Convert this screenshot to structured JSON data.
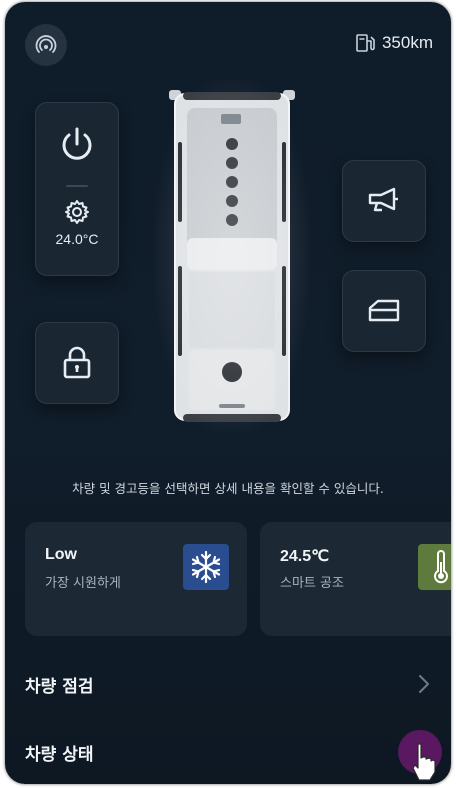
{
  "header": {
    "range_value": "350km",
    "icons": [
      "signal-icon",
      "fuel-pump-icon"
    ]
  },
  "climate_control": {
    "temperature": "24.0°C",
    "icons": [
      "power-icon",
      "gear-icon"
    ]
  },
  "controls": {
    "lock_icon": "lock-icon",
    "horn_icon": "horn-icon",
    "window_icon": "window-icon"
  },
  "hint_text": "차량 및 경고등을 선택하면 상세 내용을 확인할 수 있습니다.",
  "cards": [
    {
      "title": "Low",
      "subtitle": "가장 시원하게",
      "icon": "snowflake-icon",
      "icon_bg": "#2a4d8f"
    },
    {
      "title": "24.5℃",
      "subtitle": "스마트 공조",
      "icon": "thermometer-icon",
      "icon_bg": "#5e7a3c"
    }
  ],
  "menu": [
    {
      "label": "차량 점검"
    },
    {
      "label": "차량 상태"
    }
  ],
  "colors": {
    "background": "#0f1c29",
    "tile": "#1a2733",
    "card": "#1c2834",
    "fab": "#5a1860"
  }
}
